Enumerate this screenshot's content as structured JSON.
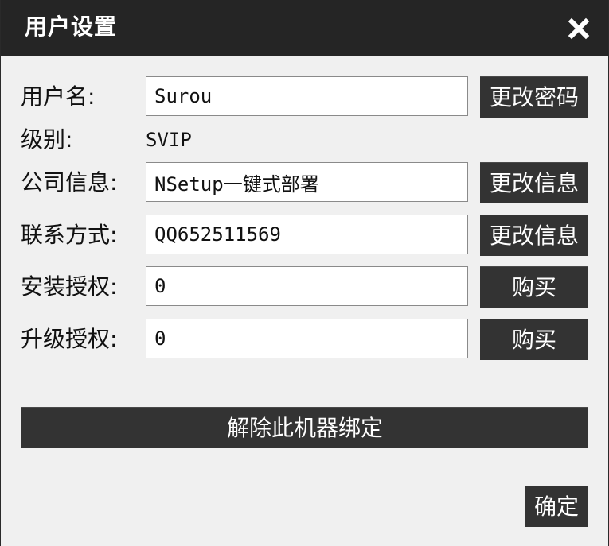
{
  "window": {
    "title": "用户设置"
  },
  "form": {
    "username": {
      "label": "用户名:",
      "value": "Surou",
      "button": "更改密码"
    },
    "level": {
      "label": "级别:",
      "value": "SVIP"
    },
    "company": {
      "label": "公司信息:",
      "value": "NSetup一键式部署",
      "button": "更改信息"
    },
    "contact": {
      "label": "联系方式:",
      "value": "QQ652511569",
      "button": "更改信息"
    },
    "install_license": {
      "label": "安装授权:",
      "value": "0",
      "button": "购买"
    },
    "upgrade_license": {
      "label": "升级授权:",
      "value": "0",
      "button": "购买"
    }
  },
  "actions": {
    "unbind": "解除此机器绑定",
    "ok": "确定"
  },
  "colors": {
    "titlebar": "#252525",
    "button": "#333333",
    "background": "#f0f0f0"
  },
  "icons": {
    "close": "close-icon"
  }
}
